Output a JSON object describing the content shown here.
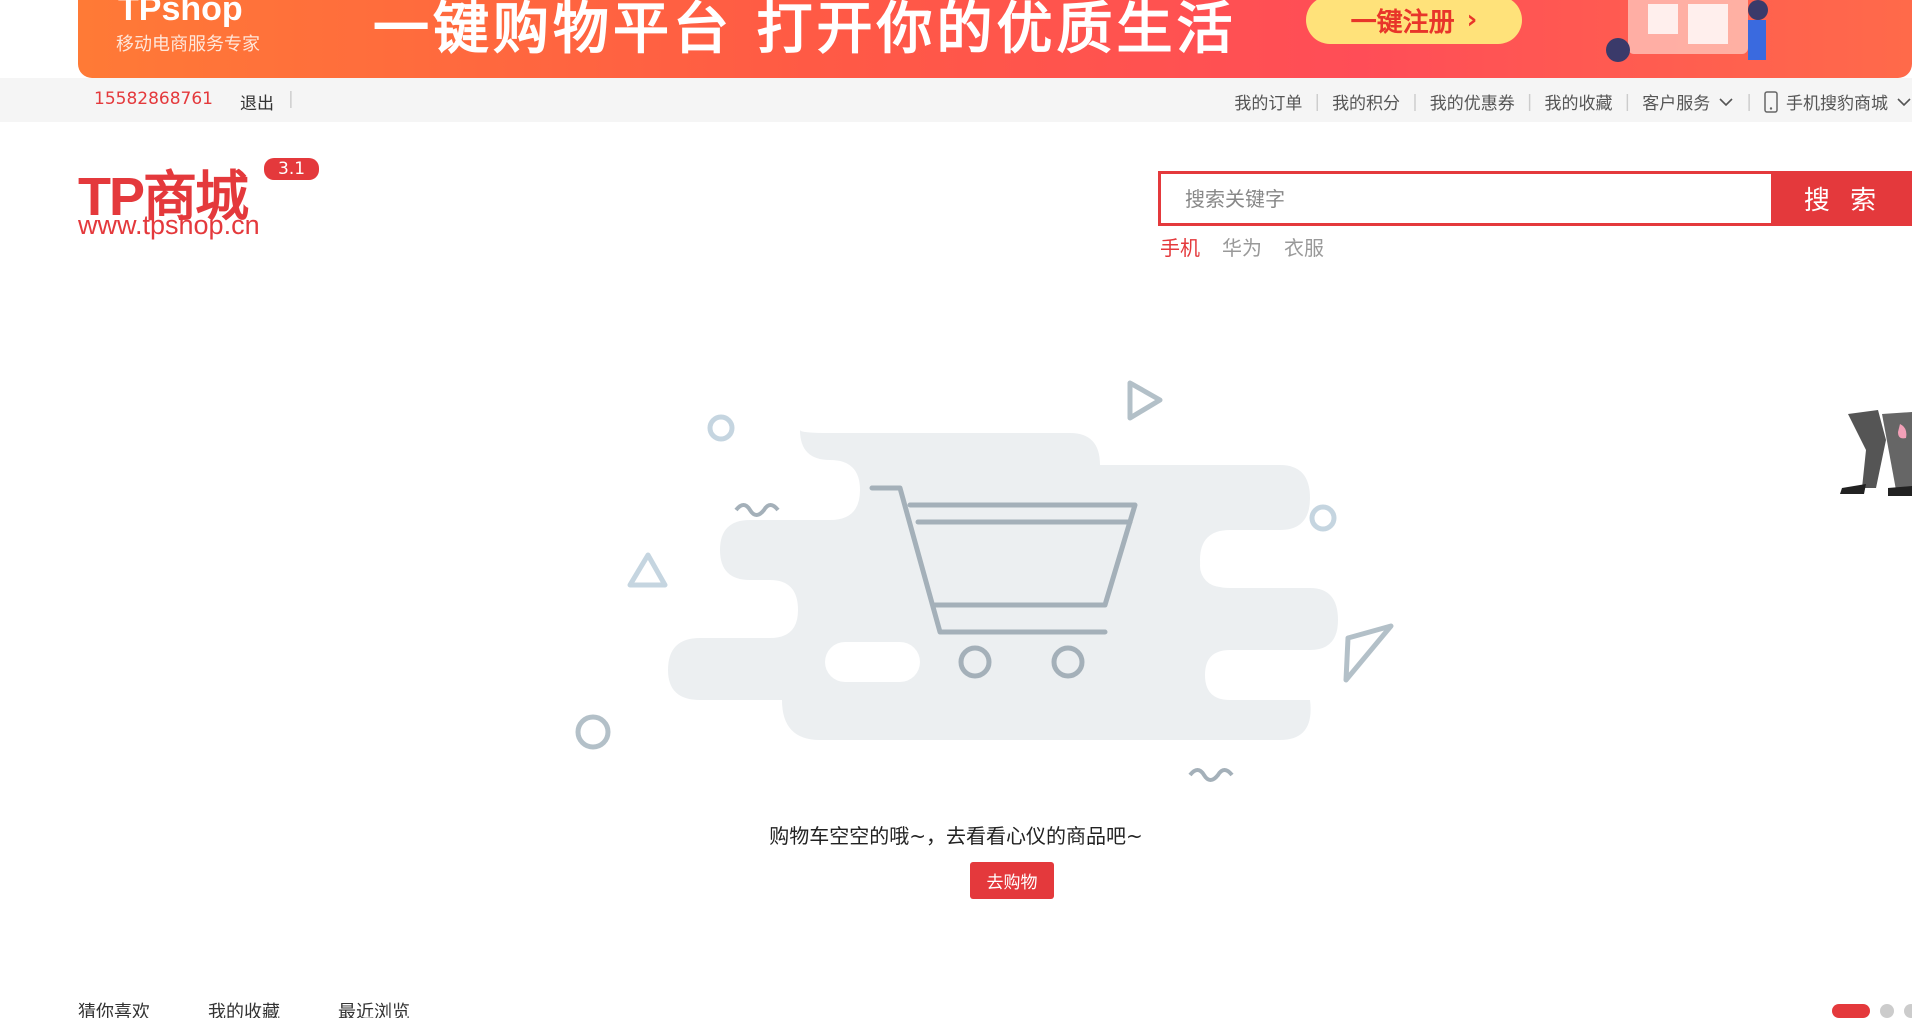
{
  "banner": {
    "brand": "TPshop",
    "subtitle": "移动电商服务专家",
    "slogan": "一键购物平台 打开你的优质生活",
    "cta": "一键注册"
  },
  "topbar": {
    "phone": "15582868761",
    "logout": "退出",
    "nav": [
      "我的订单",
      "我的积分",
      "我的优惠券",
      "我的收藏",
      "客户服务",
      "手机搜豹商城"
    ]
  },
  "logo": {
    "main": "TP商城",
    "version": "3.1",
    "url": "www.tpshop.cn"
  },
  "search": {
    "placeholder": "搜索关键字",
    "button": "搜 索",
    "hotwords": [
      "手机",
      "华为",
      "衣服"
    ]
  },
  "empty_cart": {
    "message": "购物车空空的哦~，去看看心仪的商品吧~",
    "button": "去购物"
  },
  "bottom_tabs": [
    "猜你喜欢",
    "我的收藏",
    "最近浏览"
  ],
  "colors": {
    "accent": "#e4393c",
    "illustration": "#a9b7c2",
    "cloud": "#eceff1"
  }
}
